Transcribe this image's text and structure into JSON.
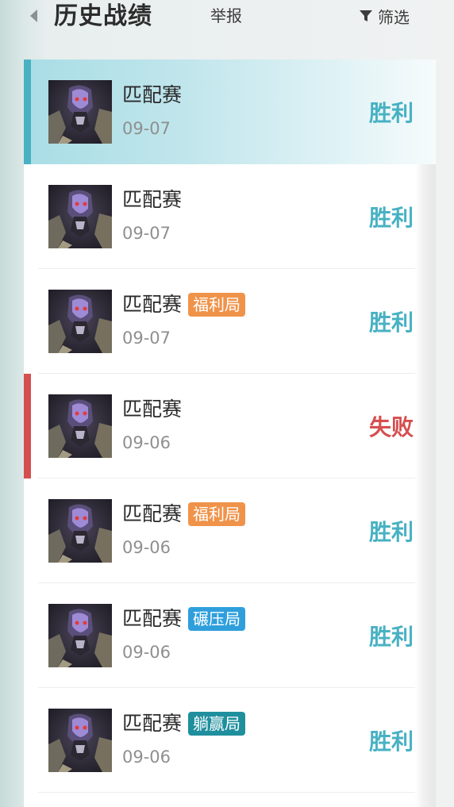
{
  "header": {
    "title": "历史战绩",
    "report": "举报",
    "filter": "筛选"
  },
  "colors": {
    "win": "#48b1c3",
    "loss": "#d64f4f",
    "tag_welfare": "#f0934a",
    "tag_crush": "#2f9fdc",
    "tag_carried": "#1f8f9e"
  },
  "matches": [
    {
      "mode": "匹配赛",
      "date": "09-07",
      "result": "胜利",
      "outcome": "win",
      "tag": "",
      "tag_type": ""
    },
    {
      "mode": "匹配赛",
      "date": "09-07",
      "result": "胜利",
      "outcome": "win",
      "tag": "",
      "tag_type": ""
    },
    {
      "mode": "匹配赛",
      "date": "09-07",
      "result": "胜利",
      "outcome": "win",
      "tag": "福利局",
      "tag_type": "welfare"
    },
    {
      "mode": "匹配赛",
      "date": "09-06",
      "result": "失败",
      "outcome": "loss",
      "tag": "",
      "tag_type": ""
    },
    {
      "mode": "匹配赛",
      "date": "09-06",
      "result": "胜利",
      "outcome": "win",
      "tag": "福利局",
      "tag_type": "welfare"
    },
    {
      "mode": "匹配赛",
      "date": "09-06",
      "result": "胜利",
      "outcome": "win",
      "tag": "碾压局",
      "tag_type": "crush"
    },
    {
      "mode": "匹配赛",
      "date": "09-06",
      "result": "胜利",
      "outcome": "win",
      "tag": "躺赢局",
      "tag_type": "carried"
    }
  ]
}
